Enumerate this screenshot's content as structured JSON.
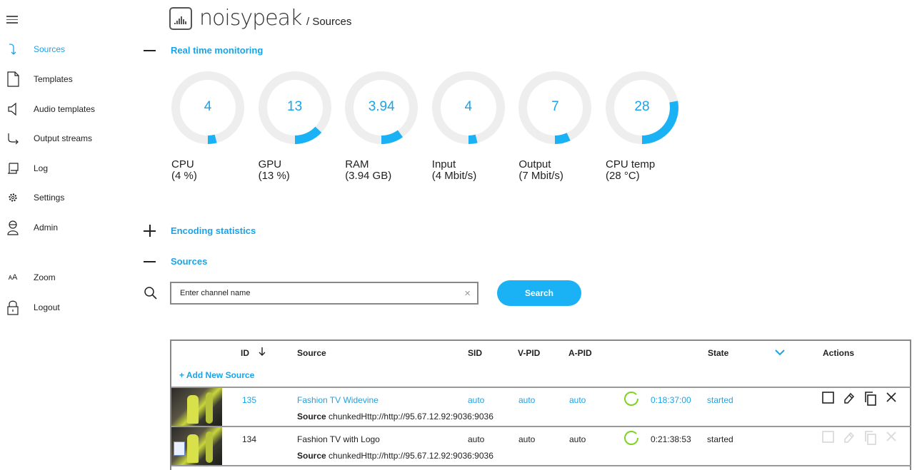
{
  "header": {
    "brand": "noisypeak",
    "breadcrumb": "/ Sources"
  },
  "sidebar": {
    "items": [
      {
        "label": "Sources",
        "icon": "arrow-down-right-icon",
        "active": true
      },
      {
        "label": "Templates",
        "icon": "document-icon"
      },
      {
        "label": "Audio templates",
        "icon": "speaker-icon"
      },
      {
        "label": "Output streams",
        "icon": "arrow-right-down-icon"
      },
      {
        "label": "Log",
        "icon": "log-icon"
      },
      {
        "label": "Settings",
        "icon": "gear-icon"
      },
      {
        "label": "Admin",
        "icon": "user-icon"
      },
      {
        "label": "Zoom",
        "icon": "text-size-icon"
      },
      {
        "label": "Logout",
        "icon": "lock-icon"
      }
    ]
  },
  "sections": {
    "realtime": "Real time monitoring",
    "encoding": "Encoding statistics",
    "sources": "Sources"
  },
  "gauges": [
    {
      "value": "4",
      "label": "CPU",
      "sub": "(4 %)",
      "fraction": 0.04
    },
    {
      "value": "13",
      "label": "GPU",
      "sub": "(13 %)",
      "fraction": 0.13
    },
    {
      "value": "3.94",
      "label": "RAM",
      "sub": "(3.94 GB)",
      "fraction": 0.1
    },
    {
      "value": "4",
      "label": "Input",
      "sub": "(4 Mbit/s)",
      "fraction": 0.04
    },
    {
      "value": "7",
      "label": "Output",
      "sub": "(7 Mbit/s)",
      "fraction": 0.07
    },
    {
      "value": "28",
      "label": "CPU temp",
      "sub": "(28 °C)",
      "fraction": 0.28
    }
  ],
  "search": {
    "placeholder": "Enter channel name",
    "button": "Search",
    "clear": "×"
  },
  "table": {
    "headers": {
      "id": "ID",
      "source": "Source",
      "sid": "SID",
      "vpid": "V-PID",
      "apid": "A-PID",
      "state": "State",
      "actions": "Actions"
    },
    "add_label": "+ Add New Source",
    "rows": [
      {
        "id": "135",
        "name": "Fashion TV Widevine",
        "sid": "auto",
        "vpid": "auto",
        "apid": "auto",
        "uptime": "0:18:37:00",
        "state": "started",
        "source_label": "Source",
        "source_url": "chunkedHttp://http://95.67.12.92:9036:9036"
      },
      {
        "id": "134",
        "name": "Fashion TV with Logo",
        "sid": "auto",
        "vpid": "auto",
        "apid": "auto",
        "uptime": "0:21:38:53",
        "state": "started",
        "source_label": "Source",
        "source_url": "chunkedHttp://http://95.67.12.92:9036:9036"
      }
    ]
  },
  "colors": {
    "accent": "#1aa3e8",
    "button": "#1ab1f5",
    "gauge_track": "#eeeeee",
    "spinner": "#7ed321"
  }
}
